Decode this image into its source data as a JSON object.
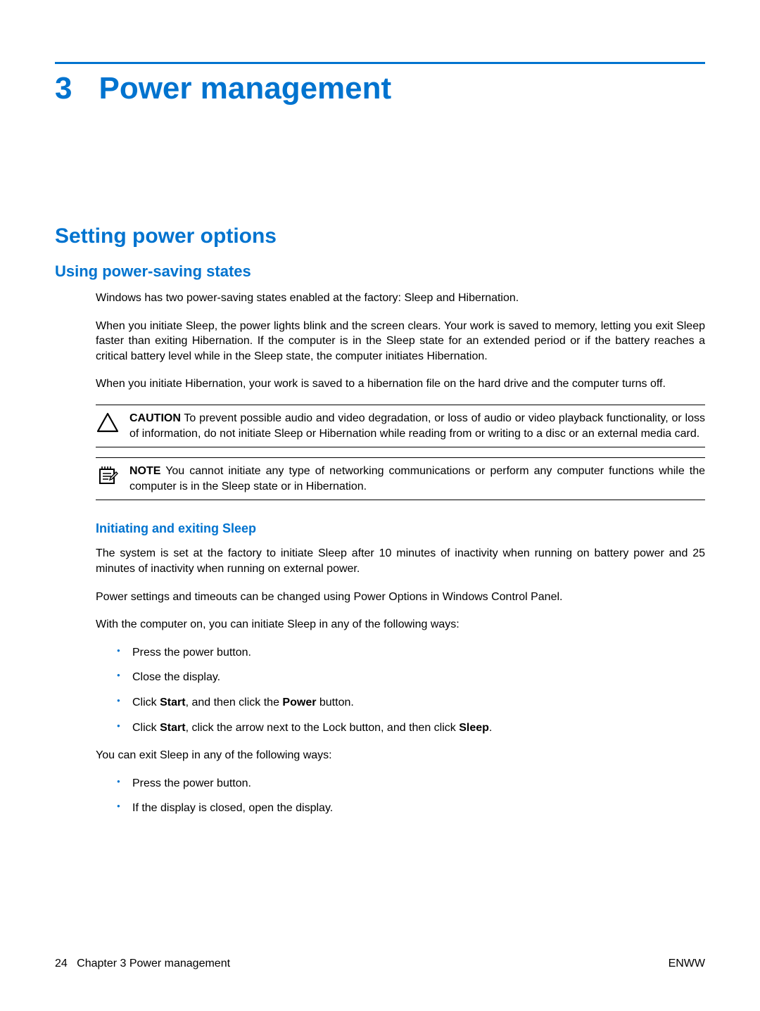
{
  "colors": {
    "accent": "#0073cf"
  },
  "chapter": {
    "number": "3",
    "title": "Power management"
  },
  "h2": "Setting power options",
  "h3": "Using power-saving states",
  "paragraphs": {
    "p1": "Windows has two power-saving states enabled at the factory: Sleep and Hibernation.",
    "p2": "When you initiate Sleep, the power lights blink and the screen clears. Your work is saved to memory, letting you exit Sleep faster than exiting Hibernation. If the computer is in the Sleep state for an extended period or if the battery reaches a critical battery level while in the Sleep state, the computer initiates Hibernation.",
    "p3": "When you initiate Hibernation, your work is saved to a hibernation file on the hard drive and the computer turns off."
  },
  "callouts": {
    "caution": {
      "label": "CAUTION",
      "text": "   To prevent possible audio and video degradation, or loss of audio or video playback functionality, or loss of information, do not initiate Sleep or Hibernation while reading from or writing to a disc or an external media card."
    },
    "note": {
      "label": "NOTE",
      "text": "   You cannot initiate any type of networking communications or perform any computer functions while the computer is in the Sleep state or in Hibernation."
    }
  },
  "h4": "Initiating and exiting Sleep",
  "sleep": {
    "p1": "The system is set at the factory to initiate Sleep after 10 minutes of inactivity when running on battery power and 25 minutes of inactivity when running on external power.",
    "p2": "Power settings and timeouts can be changed using Power Options in Windows Control Panel.",
    "p3": "With the computer on, you can initiate Sleep in any of the following ways:",
    "initiate": {
      "i1": "Press the power button.",
      "i2": "Close the display.",
      "i3_pre": "Click ",
      "i3_b1": "Start",
      "i3_mid": ", and then click the ",
      "i3_b2": "Power",
      "i3_post": " button.",
      "i4_pre": "Click ",
      "i4_b1": "Start",
      "i4_mid": ", click the arrow next to the Lock button, and then click ",
      "i4_b2": "Sleep",
      "i4_post": "."
    },
    "p4": "You can exit Sleep in any of the following ways:",
    "exit": {
      "e1": "Press the power button.",
      "e2": "If the display is closed, open the display."
    }
  },
  "footer": {
    "page": "24",
    "left": "Chapter 3   Power management",
    "right": "ENWW"
  }
}
